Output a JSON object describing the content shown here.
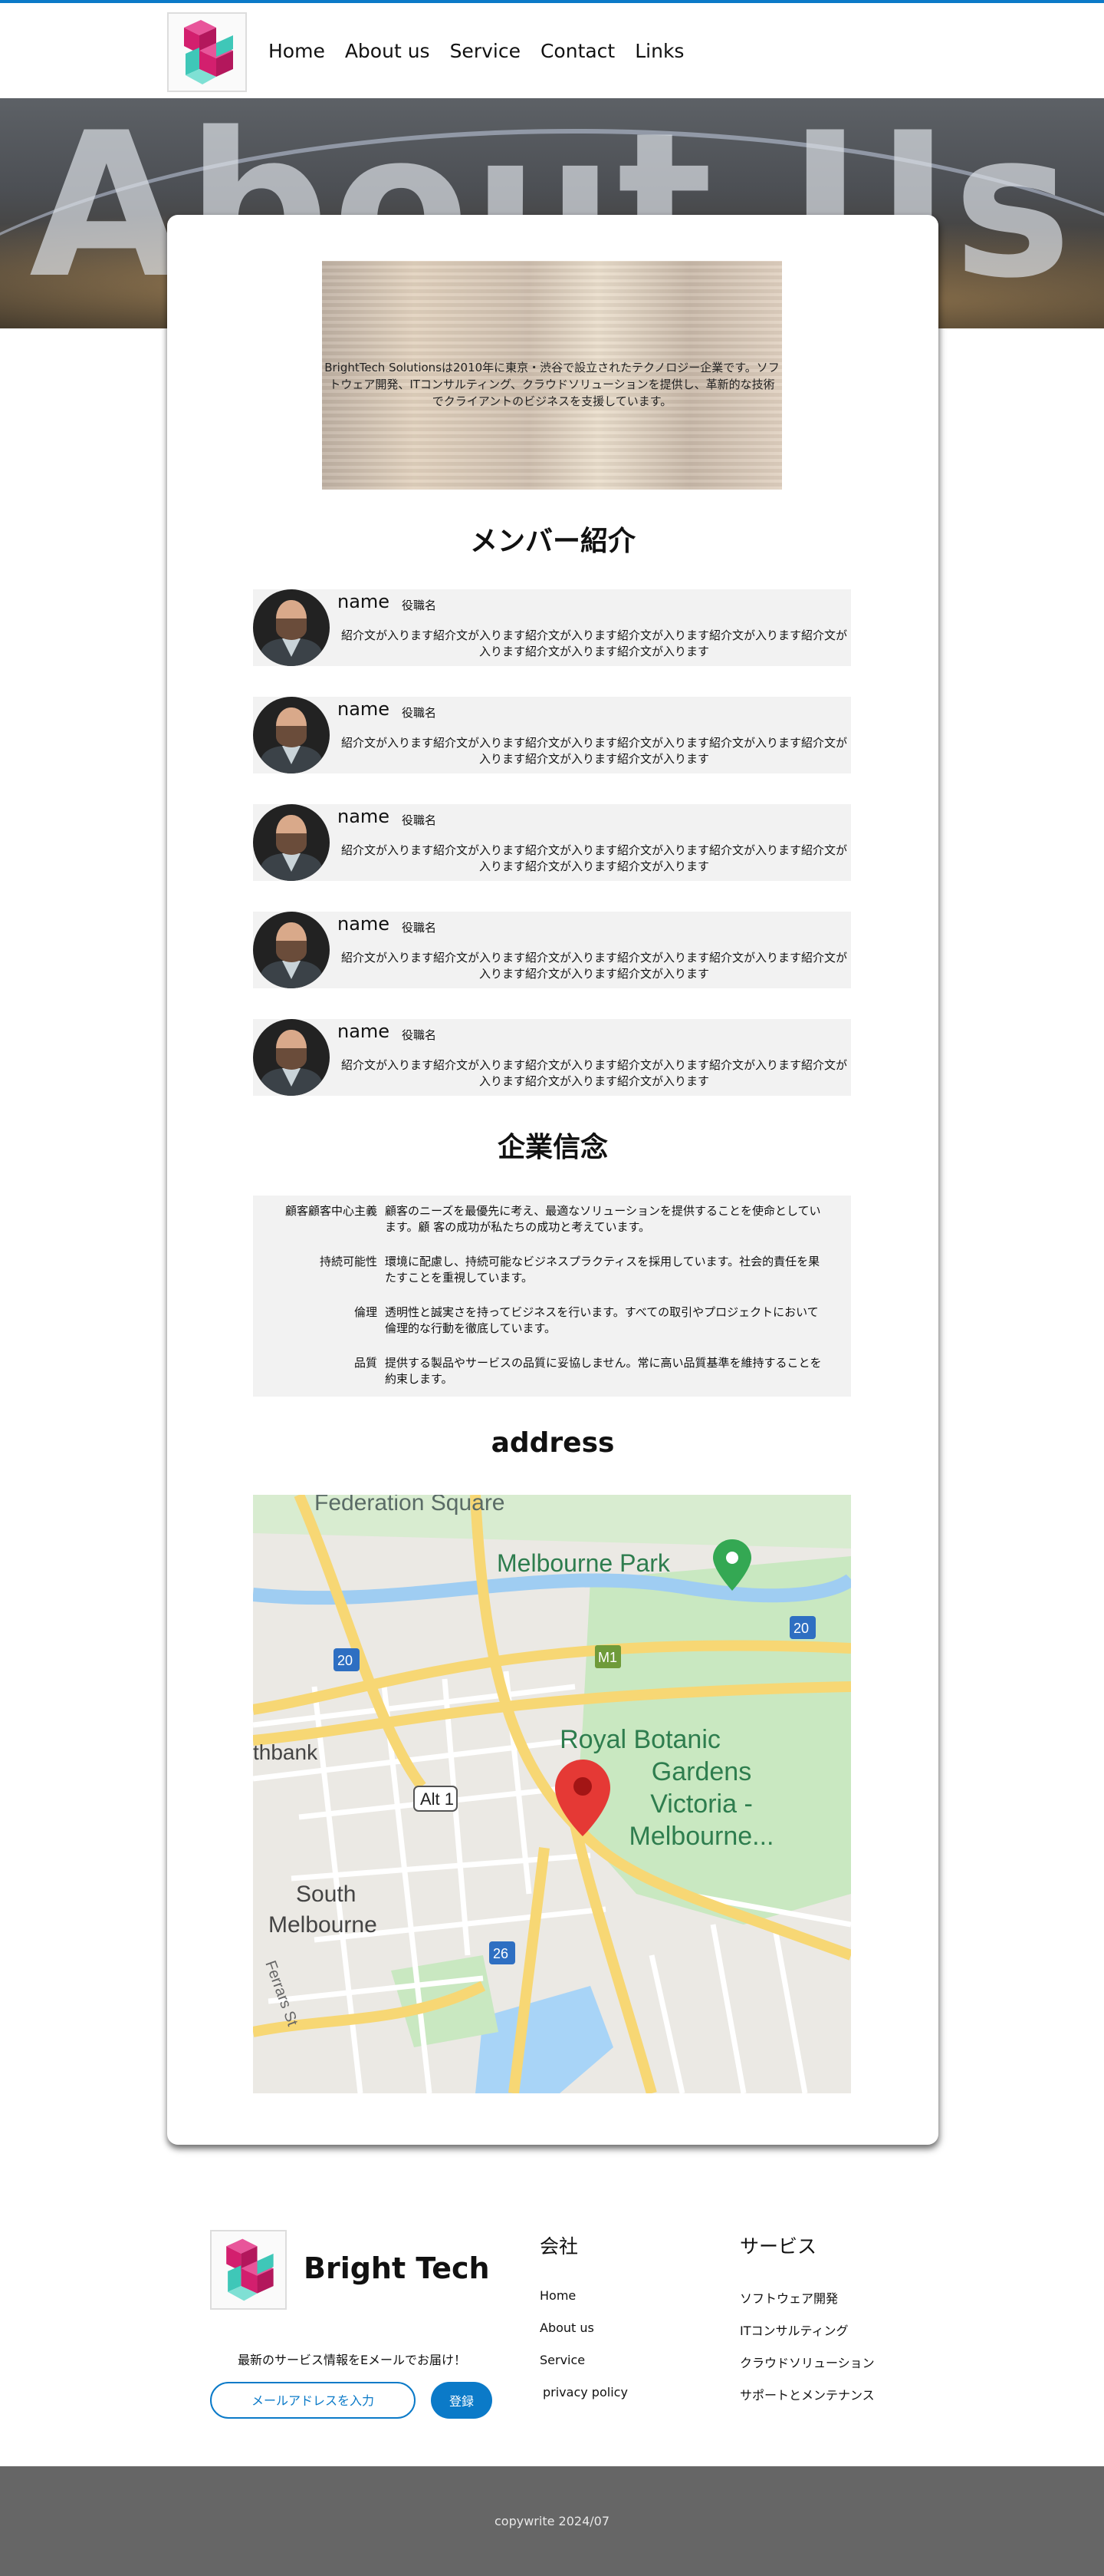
{
  "header": {
    "logo_name": "bright-tech-logo",
    "nav": [
      "Home",
      "About us",
      "Service",
      "Contact",
      "Links"
    ]
  },
  "hero": {
    "title": "About Us"
  },
  "intro": {
    "text": "BrightTech Solutionsは2010年に東京・渋谷で設立されたテクノロジー企業です。ソフトウェア開発、ITコンサルティング、クラウドソリューションを提供し、革新的な技術でクライアントのビジネスを支援しています。"
  },
  "members": {
    "title": "メンバー紹介",
    "items": [
      {
        "name": "name",
        "role": "役職名",
        "text": "紹介文が入ります紹介文が入ります紹介文が入ります紹介文が入ります紹介文が入ります紹介文が入ります紹介文が入ります紹介文が入ります"
      },
      {
        "name": "name",
        "role": "役職名",
        "text": "紹介文が入ります紹介文が入ります紹介文が入ります紹介文が入ります紹介文が入ります紹介文が入ります紹介文が入ります紹介文が入ります"
      },
      {
        "name": "name",
        "role": "役職名",
        "text": "紹介文が入ります紹介文が入ります紹介文が入ります紹介文が入ります紹介文が入ります紹介文が入ります紹介文が入ります紹介文が入ります"
      },
      {
        "name": "name",
        "role": "役職名",
        "text": "紹介文が入ります紹介文が入ります紹介文が入ります紹介文が入ります紹介文が入ります紹介文が入ります紹介文が入ります紹介文が入ります"
      },
      {
        "name": "name",
        "role": "役職名",
        "text": "紹介文が入ります紹介文が入ります紹介文が入ります紹介文が入ります紹介文が入ります紹介文が入ります紹介文が入ります紹介文が入ります"
      }
    ]
  },
  "values": {
    "title": "企業信念",
    "items": [
      {
        "key": "顧客顧客中心主義",
        "value": "顧客のニーズを最優先に考え、最適なソリューションを提供することを使命としています。顧 客の成功が私たちの成功と考えています。"
      },
      {
        "key": "持続可能性",
        "value": "環境に配慮し、持続可能なビジネスプラクティスを採用しています。社会的責任を果たすことを重視しています。"
      },
      {
        "key": "倫理",
        "value": "透明性と誠実さを持ってビジネスを行います。すべての取引やプロジェクトにおいて倫理的な行動を徹底しています。"
      },
      {
        "key": "品質",
        "value": "提供する製品やサービスの品質に妥協しません。常に高い品質基準を維持することを約束します。"
      }
    ]
  },
  "address": {
    "title": "address",
    "map": {
      "labels": [
        "Federation Square",
        "Melbourne Park",
        "thbank",
        "Alt 1",
        "Royal Botanic",
        "Gardens",
        "Victoria -",
        "Melbourne...",
        "South",
        "Melbourne",
        "Ferrars St",
        "20",
        "20",
        "M1",
        "26"
      ]
    }
  },
  "footer": {
    "brand": "Bright Tech",
    "newsletter": "最新のサービス情報をEメールでお届け！",
    "email_placeholder": "メールアドレスを入力",
    "register": "登録",
    "company_heading": "会社",
    "company_links": [
      "Home",
      "About us",
      "Service",
      "privacy policy"
    ],
    "service_heading": "サービス",
    "service_links": [
      "ソフトウェア開発",
      "ITコンサルティング",
      "クラウドソリューション",
      "サポートとメンテナンス"
    ],
    "copyright": "copywrite 2024/07"
  },
  "colors": {
    "accent": "#0b7ac8",
    "logo_pink": "#e0287a",
    "logo_teal": "#3fc7b8",
    "footer_bar": "#666666"
  }
}
